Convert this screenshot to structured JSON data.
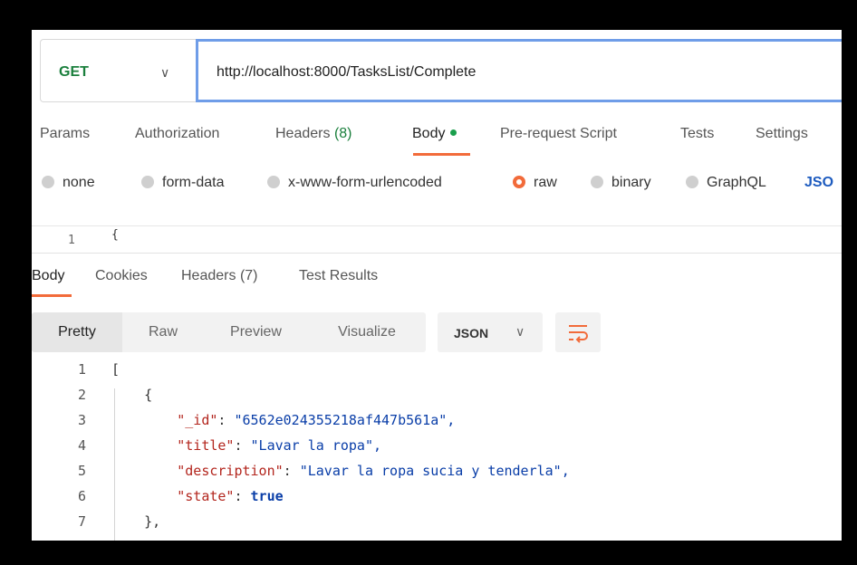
{
  "request": {
    "method": "GET",
    "url": "http://localhost:8000/TasksList/Complete"
  },
  "request_tabs": [
    {
      "label": "Params"
    },
    {
      "label": "Authorization"
    },
    {
      "label": "Headers",
      "count": "(8)"
    },
    {
      "label": "Body"
    },
    {
      "label": "Pre-request Script"
    },
    {
      "label": "Tests"
    },
    {
      "label": "Settings"
    }
  ],
  "body_types": [
    "none",
    "form-data",
    "x-www-form-urlencoded",
    "raw",
    "binary",
    "GraphQL",
    "JSO"
  ],
  "request_editor": {
    "line": "1",
    "text": "{"
  },
  "response_tabs": [
    {
      "label": "Body"
    },
    {
      "label": "Cookies"
    },
    {
      "label": "Headers",
      "count": "(7)"
    },
    {
      "label": "Test Results"
    }
  ],
  "format": {
    "buttons": [
      "Pretty",
      "Raw",
      "Preview",
      "Visualize"
    ],
    "language": "JSON"
  },
  "response_lines": [
    {
      "n": "1",
      "text": "["
    },
    {
      "n": "2",
      "text": "    {"
    },
    {
      "n": "3",
      "key": "\"_id\"",
      "value": "\"6562e024355218af447b561a\","
    },
    {
      "n": "4",
      "key": "\"title\"",
      "value": "\"Lavar la ropa\","
    },
    {
      "n": "5",
      "key": "\"description\"",
      "value": "\"Lavar la ropa sucia y tenderla\","
    },
    {
      "n": "6",
      "key": "\"state\"",
      "value": "true"
    },
    {
      "n": "7",
      "text": "    },"
    }
  ],
  "colors": {
    "accent": "#f26b3a",
    "method_green": "#1a7f3c",
    "url_border": "#6f9de8",
    "json_key": "#b3261e",
    "json_value": "#0a3ea8"
  }
}
